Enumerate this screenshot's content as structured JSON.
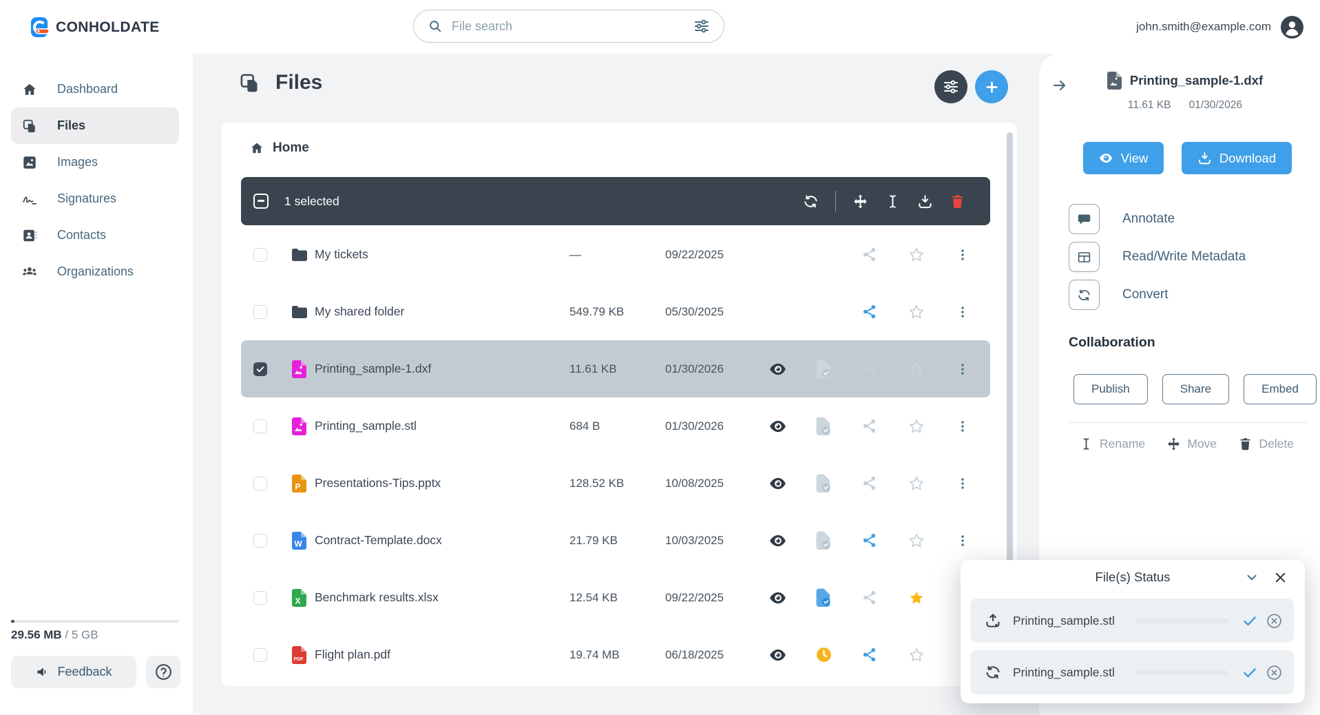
{
  "brand": {
    "logo_text": "CONHOLDATE"
  },
  "topbar": {
    "search_placeholder": "File search",
    "user_email": "john.smith@example.com"
  },
  "sidebar": {
    "items": [
      {
        "label": "Dashboard",
        "icon": "home-icon",
        "active": false
      },
      {
        "label": "Files",
        "icon": "files-icon",
        "active": true
      },
      {
        "label": "Images",
        "icon": "images-icon",
        "active": false
      },
      {
        "label": "Signatures",
        "icon": "signature-icon",
        "active": false
      },
      {
        "label": "Contacts",
        "icon": "contacts-icon",
        "active": false
      },
      {
        "label": "Organizations",
        "icon": "organizations-icon",
        "active": false
      }
    ],
    "storage_used": "29.56 MB",
    "storage_sep": " / ",
    "storage_total": "5 GB",
    "feedback_label": "Feedback"
  },
  "main": {
    "title": "Files",
    "breadcrumb": "Home",
    "selection_toolbar": {
      "selected_text": "1 selected"
    },
    "rows": [
      {
        "type": "folder",
        "name": "My tickets",
        "size": "—",
        "date": "09/22/2025",
        "selected": false,
        "checked": false,
        "preview": false,
        "status": "none",
        "share": "muted",
        "star": "off"
      },
      {
        "type": "folder",
        "name": "My shared folder",
        "size": "549.79 KB",
        "date": "05/30/2025",
        "selected": false,
        "checked": false,
        "preview": false,
        "status": "none",
        "share": "active",
        "star": "off"
      },
      {
        "type": "cad",
        "name": "Printing_sample-1.dxf",
        "size": "11.61 KB",
        "date": "01/30/2026",
        "selected": true,
        "checked": true,
        "preview": true,
        "status": "muted",
        "share": "muted",
        "star": "off"
      },
      {
        "type": "cad",
        "name": "Printing_sample.stl",
        "size": "684 B",
        "date": "01/30/2026",
        "selected": false,
        "checked": false,
        "preview": true,
        "status": "muted",
        "share": "muted",
        "star": "off"
      },
      {
        "type": "ppt",
        "name": "Presentations-Tips.pptx",
        "size": "128.52 KB",
        "date": "10/08/2025",
        "selected": false,
        "checked": false,
        "preview": true,
        "status": "muted",
        "share": "muted",
        "star": "off"
      },
      {
        "type": "doc",
        "name": "Contract-Template.docx",
        "size": "21.79 KB",
        "date": "10/03/2025",
        "selected": false,
        "checked": false,
        "preview": true,
        "status": "muted",
        "share": "active",
        "star": "off"
      },
      {
        "type": "xls",
        "name": "Benchmark results.xlsx",
        "size": "12.54 KB",
        "date": "09/22/2025",
        "selected": false,
        "checked": false,
        "preview": true,
        "status": "active",
        "share": "muted",
        "star": "on"
      },
      {
        "type": "pdf",
        "name": "Flight plan.pdf",
        "size": "19.74 MB",
        "date": "06/18/2025",
        "selected": false,
        "checked": false,
        "preview": true,
        "status": "clock",
        "share": "active",
        "star": "off"
      }
    ]
  },
  "details_panel": {
    "file_name": "Printing_sample-1.dxf",
    "file_size": "11.61 KB",
    "file_date": "01/30/2026",
    "view_label": "View",
    "download_label": "Download",
    "actions": [
      {
        "label": "Annotate",
        "icon": "comment-icon"
      },
      {
        "label": "Read/Write Metadata",
        "icon": "table-icon"
      },
      {
        "label": "Convert",
        "icon": "convert-icon"
      }
    ],
    "collaboration_title": "Collaboration",
    "collaboration_buttons": [
      "Publish",
      "Share",
      "Embed"
    ],
    "file_operations": [
      {
        "label": "Rename",
        "icon": "rename-icon"
      },
      {
        "label": "Move",
        "icon": "move-icon"
      },
      {
        "label": "Delete",
        "icon": "trash-icon"
      }
    ]
  },
  "status_popup": {
    "title": "File(s) Status",
    "items": [
      {
        "icon": "upload-icon",
        "name": "Printing_sample.stl",
        "progress_percent": 100,
        "state": "done"
      },
      {
        "icon": "sync-icon",
        "name": "Printing_sample.stl",
        "progress_percent": 100,
        "state": "done"
      }
    ]
  },
  "colors": {
    "primary_blue": "#3f9fe8",
    "dark_slate": "#3a4551",
    "selected_row": "#c3cbd2",
    "star_gold": "#fbb713",
    "clock_yellow": "#f6b51e",
    "trash_red": "#e8473f",
    "cad_magenta": "#e620d9",
    "ppt_orange": "#e79210",
    "doc_blue": "#3788e8",
    "xls_green": "#2fa84f",
    "pdf_red": "#dd3b33",
    "folder_slate": "#3e4a56"
  }
}
